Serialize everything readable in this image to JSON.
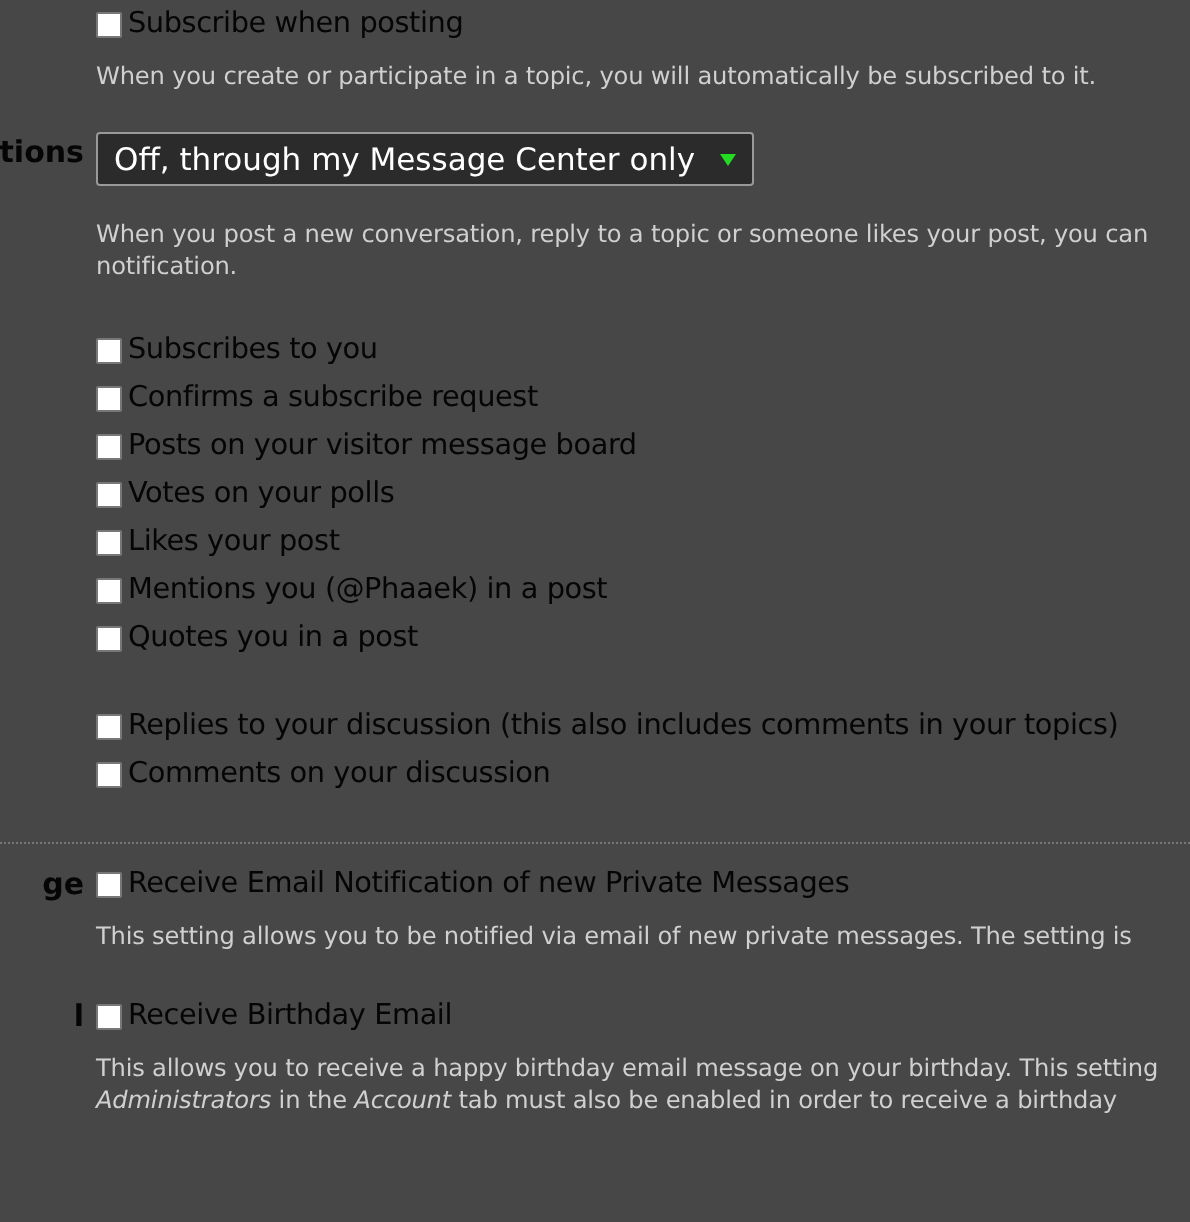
{
  "rows": [
    {
      "label": null,
      "option": {
        "label": "Subscribe when posting",
        "checked": false
      },
      "description": [
        "When you create or participate in a topic, you will automatically be subscribed to it."
      ]
    },
    {
      "label": "tions",
      "select": {
        "value": "Off, through my Message Center only"
      },
      "description": [
        "When you post a new conversation, reply to a topic or someone likes your post, you can",
        "notification."
      ],
      "option_groups": [
        [
          {
            "label": "Subscribes to you",
            "checked": false
          },
          {
            "label": "Confirms a subscribe request",
            "checked": false
          },
          {
            "label": "Posts on your visitor message board",
            "checked": false
          },
          {
            "label": "Votes on your polls",
            "checked": false
          },
          {
            "label": "Likes your post",
            "checked": false
          },
          {
            "label": "Mentions you (@Phaaek) in a post",
            "checked": false
          },
          {
            "label": "Quotes you in a post",
            "checked": false
          }
        ],
        [
          {
            "label": "Replies to your discussion (this also includes comments in your topics)",
            "checked": false
          },
          {
            "label": "Comments on your discussion",
            "checked": false
          }
        ]
      ]
    },
    {
      "divider": true,
      "label": "ge",
      "option": {
        "label": "Receive Email Notification of new Private Messages",
        "checked": false
      },
      "description": [
        "This setting allows you to be notified via email of new private messages. The setting is"
      ]
    },
    {
      "label": "l",
      "option": {
        "label": "Receive Birthday Email",
        "checked": false
      },
      "description": [
        "This allows you to receive a happy birthday email message on your birthday. This setting",
        "*Administrators* in the *Account* tab must also be enabled in order to receive a birthday"
      ]
    }
  ]
}
